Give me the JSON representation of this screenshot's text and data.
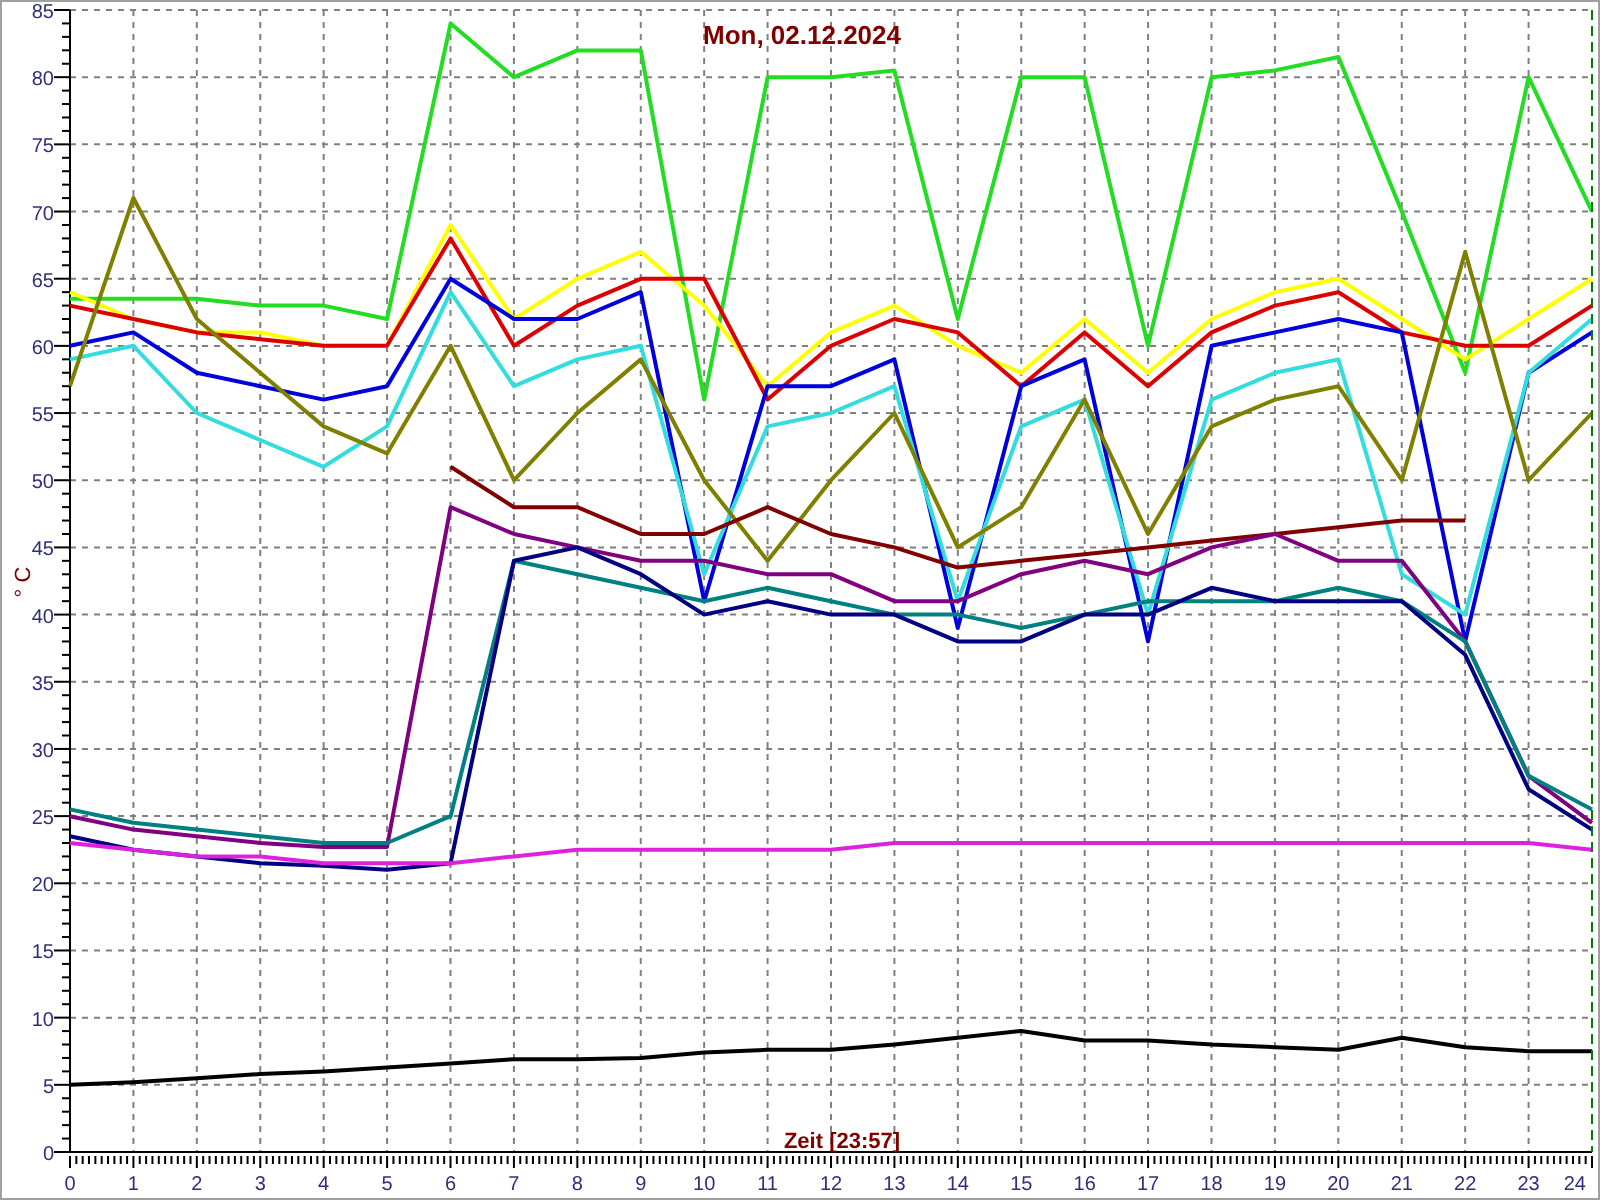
{
  "chart": {
    "chart_data": {
      "type": "line",
      "title": "Mon, 02.12.2024",
      "xlabel": "Zeit [23:57]",
      "ylabel": "° C",
      "x": [
        0,
        1,
        2,
        3,
        4,
        5,
        6,
        7,
        8,
        9,
        10,
        11,
        12,
        13,
        14,
        15,
        16,
        17,
        18,
        19,
        20,
        21,
        22,
        23,
        24
      ],
      "xlim": [
        0,
        24
      ],
      "ylim": [
        0,
        85
      ],
      "grid": true,
      "xticks": [
        0,
        1,
        2,
        3,
        4,
        5,
        6,
        7,
        8,
        9,
        10,
        11,
        12,
        13,
        14,
        15,
        16,
        17,
        18,
        19,
        20,
        21,
        22,
        23,
        24
      ],
      "yticks": [
        0,
        5,
        10,
        15,
        20,
        25,
        30,
        35,
        40,
        45,
        50,
        55,
        60,
        65,
        70,
        75,
        80,
        85
      ],
      "series": [
        {
          "color": "#22dd22",
          "values": [
            63.5,
            63.5,
            63.5,
            63,
            63,
            62,
            84,
            80,
            82,
            82,
            56,
            80,
            80,
            80.5,
            62,
            80,
            80,
            60,
            80,
            80.5,
            81.5,
            70,
            58,
            80,
            70
          ]
        },
        {
          "color": "#ffff00",
          "values": [
            64,
            62,
            61,
            61,
            60,
            60,
            69,
            62,
            65,
            67,
            63,
            57,
            61,
            63,
            60,
            58,
            62,
            58,
            62,
            64,
            65,
            62,
            59,
            62,
            65
          ]
        },
        {
          "color": "#dd0000",
          "values": [
            63,
            62,
            61,
            60.5,
            60,
            60,
            68,
            60,
            63,
            65,
            65,
            56,
            60,
            62,
            61,
            57,
            61,
            57,
            61,
            63,
            64,
            61,
            60,
            60,
            63
          ]
        },
        {
          "color": "#0000dd",
          "values": [
            60,
            61,
            58,
            57,
            56,
            57,
            65,
            62,
            62,
            64,
            41,
            57,
            57,
            59,
            39,
            57,
            59,
            38,
            60,
            61,
            62,
            61,
            38,
            58,
            61
          ]
        },
        {
          "color": "#33dddd",
          "values": [
            59,
            60,
            55,
            53,
            51,
            54,
            64,
            57,
            59,
            60,
            43,
            54,
            55,
            57,
            41,
            54,
            56,
            40,
            56,
            58,
            59,
            43,
            40,
            58,
            62
          ]
        },
        {
          "color": "#808000",
          "values": [
            57,
            71,
            62,
            58,
            54,
            52,
            60,
            50,
            55,
            59,
            50,
            44,
            50,
            55,
            45,
            48,
            56,
            46,
            54,
            56,
            57,
            50,
            67,
            50,
            55
          ]
        },
        {
          "color": "#800000",
          "values": [
            null,
            null,
            null,
            null,
            null,
            null,
            51,
            48,
            48,
            46,
            46,
            48,
            46,
            45,
            43.5,
            44,
            44.5,
            45,
            45.5,
            46,
            46.5,
            47,
            47,
            null,
            null
          ]
        },
        {
          "color": "#800080",
          "values": [
            25,
            24,
            23.5,
            23,
            22.7,
            22.7,
            48,
            46,
            45,
            44,
            44,
            43,
            43,
            41,
            41,
            43,
            44,
            43,
            45,
            46,
            44,
            44,
            38,
            28,
            24.5
          ]
        },
        {
          "color": "#008080",
          "values": [
            25.5,
            24.5,
            24,
            23.5,
            23,
            23,
            25,
            44,
            43,
            42,
            41,
            42,
            41,
            40,
            40,
            39,
            40,
            41,
            41,
            41,
            42,
            41,
            38,
            28,
            25.5
          ]
        },
        {
          "color": "#000080",
          "values": [
            23.5,
            22.5,
            22,
            21.5,
            21.3,
            21,
            21.5,
            44,
            45,
            43,
            40,
            41,
            40,
            40,
            38,
            38,
            40,
            40,
            42,
            41,
            41,
            41,
            37,
            27,
            24
          ]
        },
        {
          "color": "#dd22dd",
          "values": [
            23,
            22.5,
            22,
            22,
            21.5,
            21.5,
            21.5,
            22,
            22.5,
            22.5,
            22.5,
            22.5,
            22.5,
            23,
            23,
            23,
            23,
            23,
            23,
            23,
            23,
            23,
            23,
            23,
            22.5
          ]
        },
        {
          "color": "#000000",
          "values": [
            5,
            5.2,
            5.5,
            5.8,
            6,
            6.3,
            6.6,
            6.9,
            6.9,
            7,
            7.4,
            7.6,
            7.6,
            8,
            8.5,
            9,
            8.3,
            8.3,
            8,
            7.8,
            7.6,
            8.5,
            7.8,
            7.5,
            7.5
          ]
        }
      ]
    }
  }
}
